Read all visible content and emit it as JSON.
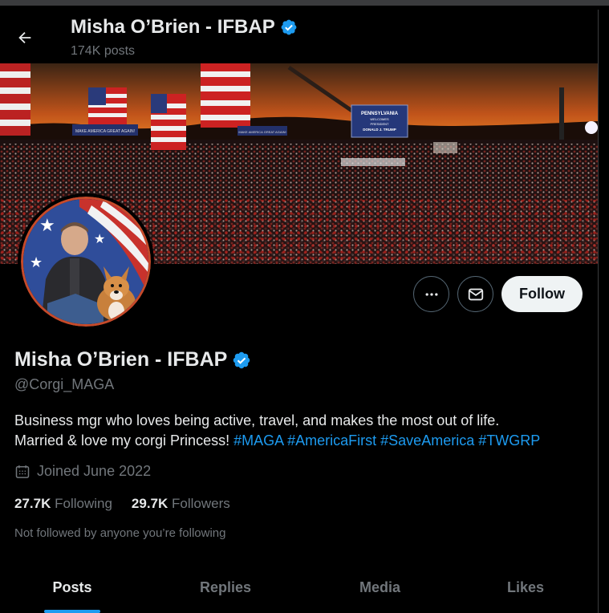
{
  "header": {
    "title": "Misha O’Brien - IFBAP",
    "post_count": "174K posts"
  },
  "banner": {
    "sign_text_1": "PENNSYLVANIA",
    "sign_text_2": "WELCOMES",
    "sign_text_3": "PRESIDENT",
    "sign_text_4": "DONALD J. TRUMP",
    "banner_small_1": "MAKE AMERICA GREAT AGAIN!",
    "banner_small_2": "MAKE AMERICA GREAT AGAIN!"
  },
  "actions": {
    "more_icon": "more-horizontal",
    "message_icon": "envelope",
    "follow_label": "Follow"
  },
  "profile": {
    "name": "Misha O’Brien - IFBAP",
    "handle": "@Corgi_MAGA",
    "bio_line1": "Business mgr who loves being active, travel, and makes the most out of life.",
    "bio_line2_text": "Married & love my corgi Princess! ",
    "hashtags": [
      "#MAGA",
      "#AmericaFirst",
      "#SaveAmerica",
      "#TWGRP"
    ],
    "joined": "Joined June 2022",
    "following_count": "27.7K",
    "following_label": "Following",
    "followers_count": "29.7K",
    "followers_label": "Followers",
    "not_followed": "Not followed by anyone you’re following"
  },
  "tabs": [
    {
      "label": "Posts",
      "active": true
    },
    {
      "label": "Replies",
      "active": false
    },
    {
      "label": "Media",
      "active": false
    },
    {
      "label": "Likes",
      "active": false
    }
  ],
  "colors": {
    "accent": "#1d9bf0",
    "verified": "#1d9bf0",
    "background": "#000000",
    "text_secondary": "#71767b"
  }
}
